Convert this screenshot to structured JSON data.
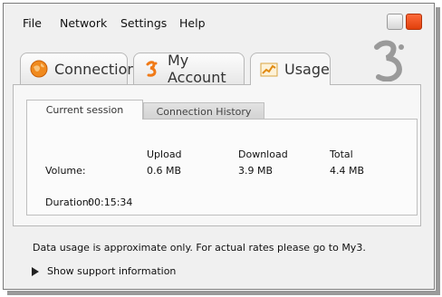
{
  "menu": [
    "File",
    "Network",
    "Settings",
    "Help"
  ],
  "window_buttons": {
    "minimize_icon": "minimize-icon",
    "close_icon": "close-icon"
  },
  "logo": {
    "icon": "three-logo-icon",
    "color": "#9a9a9a"
  },
  "tabs": [
    {
      "label": "Connection",
      "icon": "globe-icon",
      "active": false
    },
    {
      "label": "My Account",
      "icon": "three-brand-icon",
      "active": false
    },
    {
      "label": "Usage",
      "icon": "chart-icon",
      "active": true
    }
  ],
  "subtabs": [
    {
      "label": "Current session",
      "active": true
    },
    {
      "label": "Connection History",
      "active": false
    }
  ],
  "session": {
    "columns": [
      "Upload",
      "Download",
      "Total"
    ],
    "volume_label": "Volume:",
    "volume_values": [
      "0.6 MB",
      "3.9 MB",
      "4.4 MB"
    ],
    "duration_label": "Duration:",
    "duration_value": "00:15:34"
  },
  "note": "Data usage is approximate only. For actual rates please go to My3.",
  "support_label": "Show support information",
  "colors": {
    "close_button": "#ea4a14",
    "accent_orange": "#f07a17",
    "background": "#f0f0f0"
  }
}
